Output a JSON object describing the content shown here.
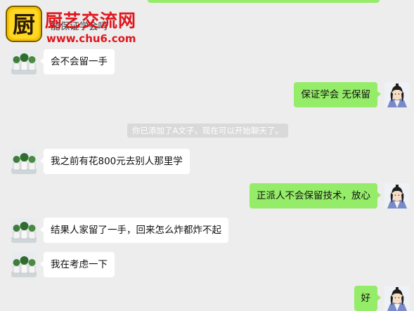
{
  "watermark": {
    "title": "厨艺交流网",
    "url": "www.chu6.com",
    "logo_char": "厨"
  },
  "partial_message": "能保证学会吗",
  "system_notice": "你已添加了A文子，现在可以开始聊天了。",
  "messages": [
    {
      "side": "left",
      "text": "会不会留一手"
    },
    {
      "side": "right",
      "text": "保证学会  无保留"
    },
    {
      "side": "left",
      "text": "我之前有花800元去别人那里学"
    },
    {
      "side": "right",
      "text": "正派人不会保留技术，放心"
    },
    {
      "side": "left",
      "text": "结果人家留了一手，回来怎么炸都炸不起"
    },
    {
      "side": "left",
      "text": "我在考虑一下"
    },
    {
      "side": "right",
      "text": "好"
    }
  ],
  "colors": {
    "background": "#ededed",
    "bubble_self": "#95ec69",
    "bubble_other": "#ffffff",
    "watermark_red": "#e0151b"
  },
  "icons": {
    "avatar_other": "potted-plants-avatar",
    "avatar_self": "swordsman-avatar"
  }
}
